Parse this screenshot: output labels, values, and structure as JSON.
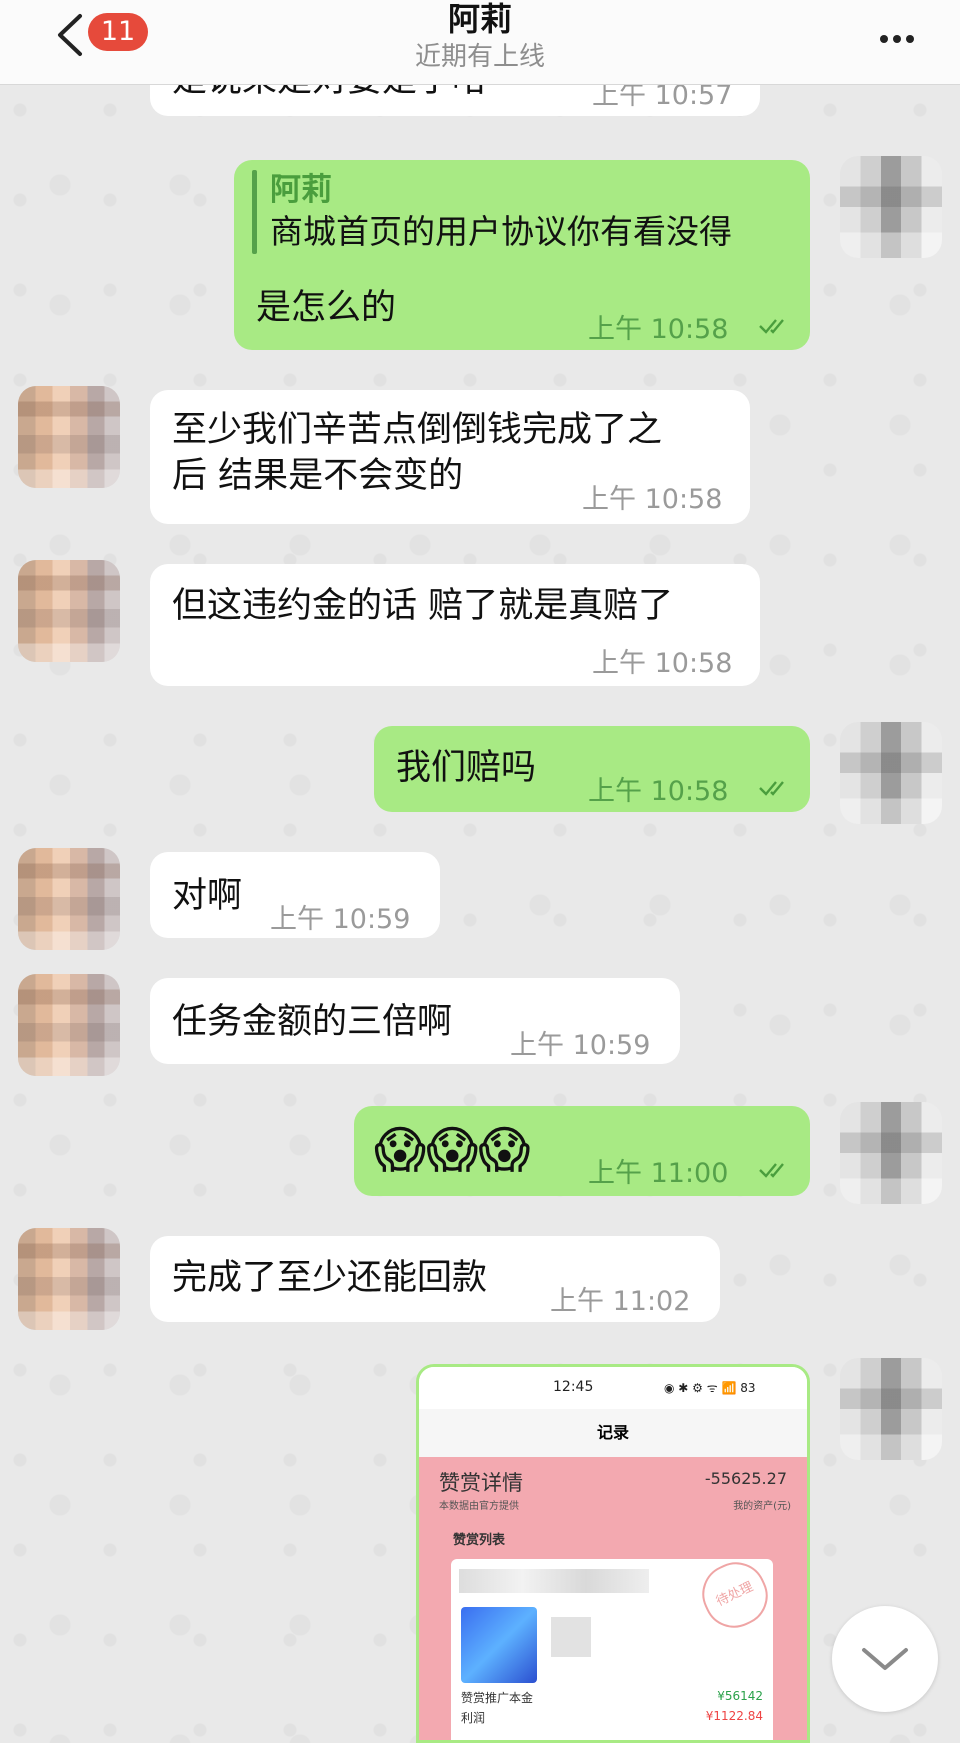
{
  "header": {
    "unread_count": "11",
    "contact_name": "阿莉",
    "status": "近期有上线"
  },
  "messages": [
    {
      "id": "m0",
      "side": "in",
      "text": "是说呆是对要是了哈",
      "time": "上午 10:57"
    },
    {
      "id": "m1",
      "side": "out",
      "reply_name": "阿莉",
      "reply_text": "商城首页的用户协议你有看没得",
      "text": "是怎么的",
      "time": "上午 10:58",
      "read": true
    },
    {
      "id": "m2",
      "side": "in",
      "text_line1": "至少我们辛苦点倒倒钱完成了之",
      "text_line2": "后 结果是不会变的",
      "time": "上午 10:58"
    },
    {
      "id": "m3",
      "side": "in",
      "text": "但这违约金的话 赔了就是真赔了",
      "time": "上午 10:58"
    },
    {
      "id": "m4",
      "side": "out",
      "text": "我们赔吗",
      "time": "上午 10:58",
      "read": true
    },
    {
      "id": "m5",
      "side": "in",
      "text": "对啊",
      "time": "上午 10:59"
    },
    {
      "id": "m6",
      "side": "in",
      "text": "任务金额的三倍啊",
      "time": "上午 10:59"
    },
    {
      "id": "m7",
      "side": "out",
      "text": "😱😱😱",
      "time": "上午 11:00",
      "read": true
    },
    {
      "id": "m8",
      "side": "in",
      "text": "完成了至少还能回款",
      "time": "上午 11:02"
    }
  ],
  "screenshot": {
    "status_time": "12:45",
    "status_icons": "◉ ✱ ⚙ ᯤ 📶 83",
    "title": "记录",
    "card_title": "赞赏详情",
    "amount": "-55625.27",
    "source_note": "本数据由官方提供",
    "asset_label": "我的资产(元)",
    "list_title": "赞赏列表",
    "stamp": "待处理",
    "row1_label": "赞赏推广本金",
    "row1_value": "¥56142",
    "row2_label": "利润",
    "row2_value": "¥1122.84"
  },
  "colors": {
    "outgoing_bubble": "#a8ea84",
    "incoming_bubble": "#ffffff",
    "badge": "#e64a3b",
    "background": "#e9e9e9"
  }
}
